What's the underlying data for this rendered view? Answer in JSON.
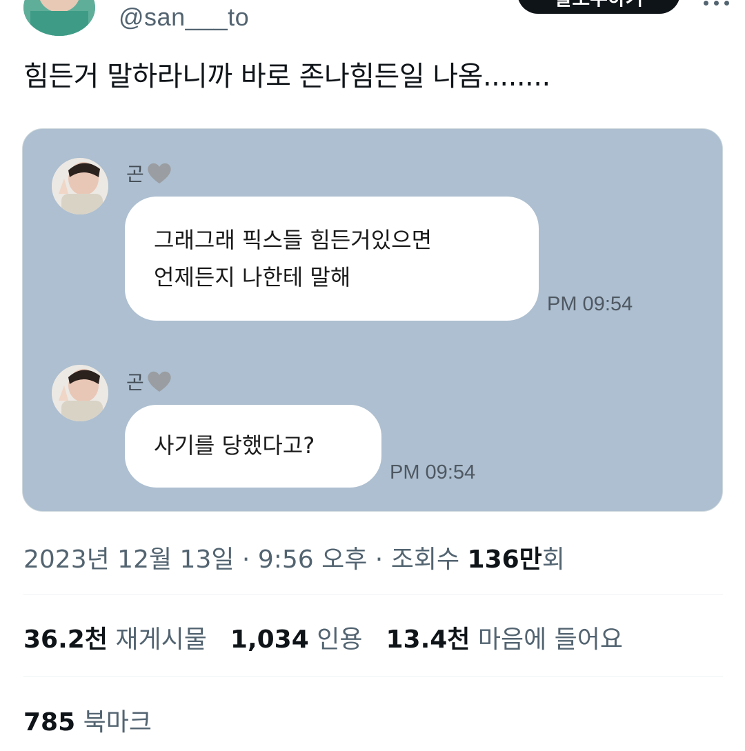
{
  "header": {
    "handle": "@san___to",
    "follow_label": "팔로우하기"
  },
  "tweet": {
    "text": "힘든거 말하라니까 바로 존나힘든일 나옴........"
  },
  "chat": {
    "messages": [
      {
        "sender": "곤",
        "lines": [
          "그래그래 픽스들 힘든거있으면",
          "언제든지 나한테 말해"
        ],
        "time": "PM 09:54"
      },
      {
        "sender": "곤",
        "lines": [
          "사기를 당했다고?"
        ],
        "time": "PM 09:54"
      }
    ],
    "colors": {
      "background": "#adbfd0",
      "bubble": "#ffffff"
    }
  },
  "meta": {
    "date": "2023년 12월 13일",
    "sep1": " · ",
    "time": "9:56 오후",
    "sep2": " · ",
    "views_label": "조회수 ",
    "views_value": "136만",
    "views_suffix": "회"
  },
  "stats": {
    "retweets_value": "36.2천",
    "retweets_label": "재게시물",
    "quotes_value": "1,034",
    "quotes_label": "인용",
    "likes_value": "13.4천",
    "likes_label": "마음에 들어요"
  },
  "bookmarks": {
    "value": "785",
    "label": "북마크"
  },
  "icons": {
    "more": "more-horizontal-icon",
    "heart": "grey-heart-icon"
  }
}
